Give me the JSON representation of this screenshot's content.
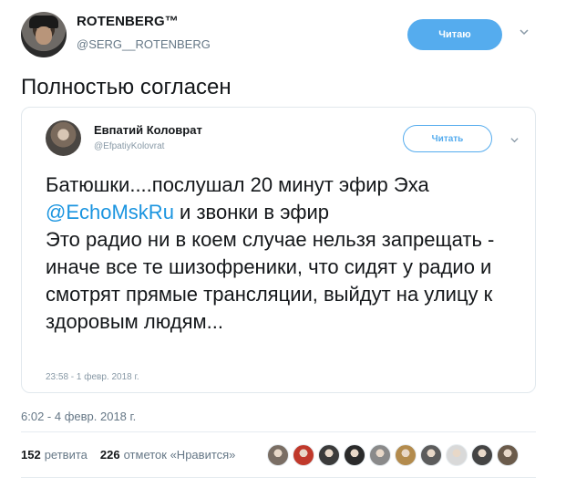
{
  "author": {
    "name": "ROTENBERG™",
    "handle": "@SERG__ROTENBERG",
    "follow_label": "Читаю"
  },
  "tweet": {
    "text": "Полностью согласен",
    "timestamp": "6:02 - 4 февр. 2018 г."
  },
  "quoted": {
    "name": "Евпатий Коловрат",
    "handle": "@EfpatiyKolovrat",
    "follow_label": "Читать",
    "line1": "Батюшки....послушал 20 минут эфир Эха",
    "mention": "@EchoMskRu",
    "line2_rest": " и звонки в эфир",
    "line3": "Это радио ни в коем случае нельзя запрещать - иначе все те шизофреники, что сидят у радио и смотрят прямые трансляции, выйдут на улицу к здоровым людям...",
    "time": "23:58 - 1 февр. 2018 г."
  },
  "stats": {
    "retweets_count": "152",
    "retweets_label": "ретвита",
    "likes_count": "226",
    "likes_label": "отметок «Нравится»"
  },
  "colors": {
    "accent": "#55acee",
    "mention": "#1b95e0",
    "muted": "#657786"
  },
  "likers": [
    "#7a6e64",
    "#c0392b",
    "#3b3b3b",
    "#2a2a2a",
    "#8a8a8a",
    "#b38b4d",
    "#5c5c5c",
    "#d9d9d9",
    "#444444",
    "#6b5b4b"
  ]
}
